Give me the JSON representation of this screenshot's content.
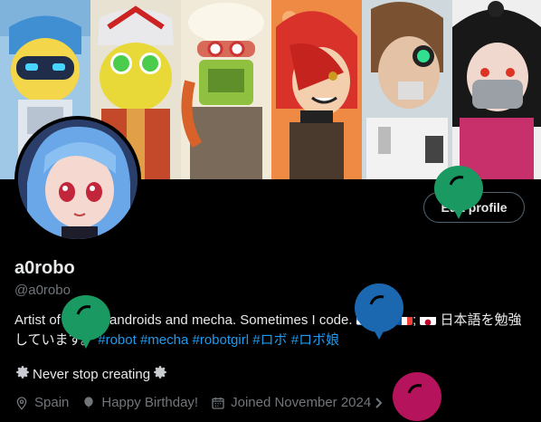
{
  "profile": {
    "name": "a0robo",
    "handle": "@a0robo",
    "edit_label": "Edit profile",
    "bio_text": "Artist of robots, androids and mecha. Sometimes I code.",
    "bio_jp": "日本語を勉強しています。",
    "hashtags": [
      "#robot",
      "#mecha",
      "#robotgirl",
      "#ロボ",
      "#ロボ娘"
    ],
    "motto": "Never stop creating",
    "location": "Spain",
    "birthday": "Happy Birthday!",
    "joined": "Joined November 2024"
  },
  "icons": [
    "gear-icon",
    "location-pin-icon",
    "balloon-icon",
    "calendar-icon",
    "chevron-right-icon"
  ],
  "colors": {
    "accent": "#1d9bf0",
    "muted": "#71767b",
    "text": "#e7e9ea",
    "balloon_green": "#1a9a62",
    "balloon_blue": "#1b68b0",
    "balloon_pink": "#b5135b"
  }
}
